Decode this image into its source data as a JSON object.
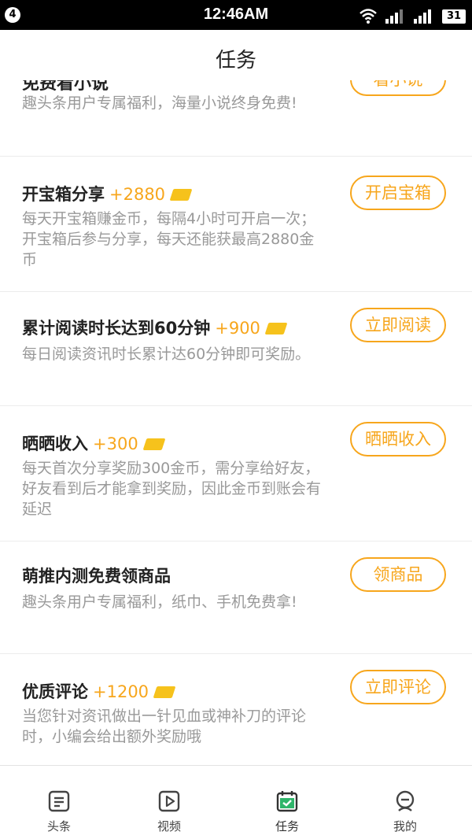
{
  "status_bar": {
    "notif_count": "4",
    "time": "12:46AM",
    "battery": "31"
  },
  "header": {
    "title": "任务"
  },
  "cut_item": {
    "title": "免费看小说",
    "desc": "趣头条用户专属福利，海量小说终身免费!",
    "button": "看小说"
  },
  "tasks": [
    {
      "title": "开宝箱分享",
      "reward": "+2880",
      "desc": "每天开宝箱赚金币，每隔4小时可开启一次；开宝箱后参与分享，每天还能获最高2880金币",
      "button": "开启宝箱",
      "icon": "gold-coin-icon"
    },
    {
      "title": "累计阅读时长达到60分钟",
      "reward": "+900",
      "desc": "每日阅读资讯时长累计达60分钟即可奖励。",
      "button": "立即阅读",
      "icon": "gold-coin-icon"
    },
    {
      "title": "晒晒收入",
      "reward": "+300",
      "desc": "每天首次分享奖励300金币，需分享给好友，好友看到后才能拿到奖励，因此金币到账会有延迟",
      "button": "晒晒收入",
      "icon": "gold-coin-icon"
    },
    {
      "title": "萌推内测免费领商品",
      "reward": "",
      "desc": "趣头条用户专属福利，纸巾、手机免费拿!",
      "button": "领商品",
      "icon": ""
    },
    {
      "title": "优质评论",
      "reward": "+1200",
      "desc": "当您针对资讯做出一针见血或神补刀的评论时，小编会给出额外奖励哦",
      "button": "立即评论",
      "icon": "gold-coin-icon"
    }
  ],
  "tabs": [
    {
      "label": "头条",
      "icon": "news-icon"
    },
    {
      "label": "视频",
      "icon": "video-play-icon"
    },
    {
      "label": "任务",
      "icon": "calendar-check-icon",
      "active": true
    },
    {
      "label": "我的",
      "icon": "profile-icon"
    }
  ],
  "colors": {
    "accent": "#f7a61c",
    "coin": "#f6c21c",
    "active_tab": "#2fb56a",
    "desc_text": "#999999"
  }
}
